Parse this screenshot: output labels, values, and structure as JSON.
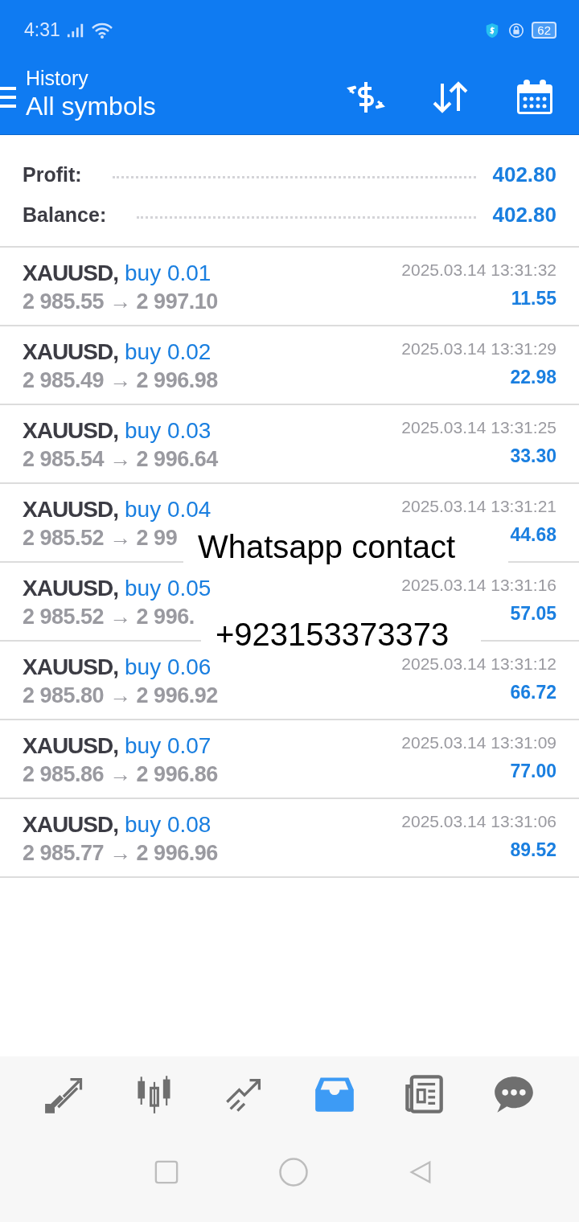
{
  "status_bar": {
    "time": "4:31",
    "battery": "62"
  },
  "header": {
    "title": "History",
    "subtitle": "All symbols"
  },
  "summary": [
    {
      "label": "Profit:",
      "value": "402.80"
    },
    {
      "label": "Balance:",
      "value": "402.80"
    }
  ],
  "deals": [
    {
      "symbol": "XAUUSD,",
      "side": "buy 0.01",
      "time": "2025.03.14 13:31:32",
      "prices": "2 985.55 → 2 997.10",
      "profit": "11.55"
    },
    {
      "symbol": "XAUUSD,",
      "side": "buy 0.02",
      "time": "2025.03.14 13:31:29",
      "prices": "2 985.49 → 2 996.98",
      "profit": "22.98"
    },
    {
      "symbol": "XAUUSD,",
      "side": "buy 0.03",
      "time": "2025.03.14 13:31:25",
      "prices": "2 985.54 → 2 996.64",
      "profit": "33.30"
    },
    {
      "symbol": "XAUUSD,",
      "side": "buy 0.04",
      "time": "2025.03.14 13:31:21",
      "prices": "2 985.52 → 2 99",
      "profit": "44.68"
    },
    {
      "symbol": "XAUUSD,",
      "side": "buy 0.05",
      "time": "2025.03.14 13:31:16",
      "prices": "2 985.52 → 2 996.",
      "profit": "57.05"
    },
    {
      "symbol": "XAUUSD,",
      "side": "buy 0.06",
      "time": "2025.03.14 13:31:12",
      "prices": "2 985.80 → 2 996.92",
      "profit": "66.72"
    },
    {
      "symbol": "XAUUSD,",
      "side": "buy 0.07",
      "time": "2025.03.14 13:31:09",
      "prices": "2 985.86 → 2 996.86",
      "profit": "77.00"
    },
    {
      "symbol": "XAUUSD,",
      "side": "buy 0.08",
      "time": "2025.03.14 13:31:06",
      "prices": "2 985.77 → 2 996.96",
      "profit": "89.52"
    }
  ],
  "overlay_labels": [
    "Whatsapp contact",
    "+923153373373"
  ],
  "bottom_nav": [
    {
      "kind": "quotes",
      "selected": false
    },
    {
      "kind": "chart",
      "selected": false
    },
    {
      "kind": "trade",
      "selected": false
    },
    {
      "kind": "history",
      "selected": true
    },
    {
      "kind": "news",
      "selected": false
    },
    {
      "kind": "chat",
      "selected": false
    }
  ]
}
